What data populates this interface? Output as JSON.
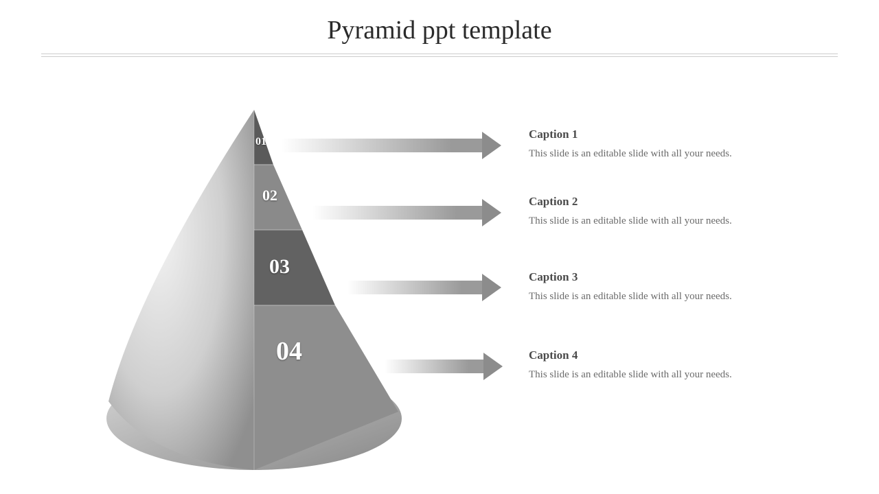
{
  "title": "Pyramid ppt template",
  "levels": [
    {
      "num": "01",
      "caption": "Caption 1",
      "desc": "This slide is an editable slide with all your needs."
    },
    {
      "num": "02",
      "caption": "Caption 2",
      "desc": "This slide is an editable slide with all your needs."
    },
    {
      "num": "03",
      "caption": "Caption 3",
      "desc": "This slide is an editable slide with all your needs."
    },
    {
      "num": "04",
      "caption": "Caption 4",
      "desc": "This slide is an editable slide with all your needs."
    }
  ]
}
